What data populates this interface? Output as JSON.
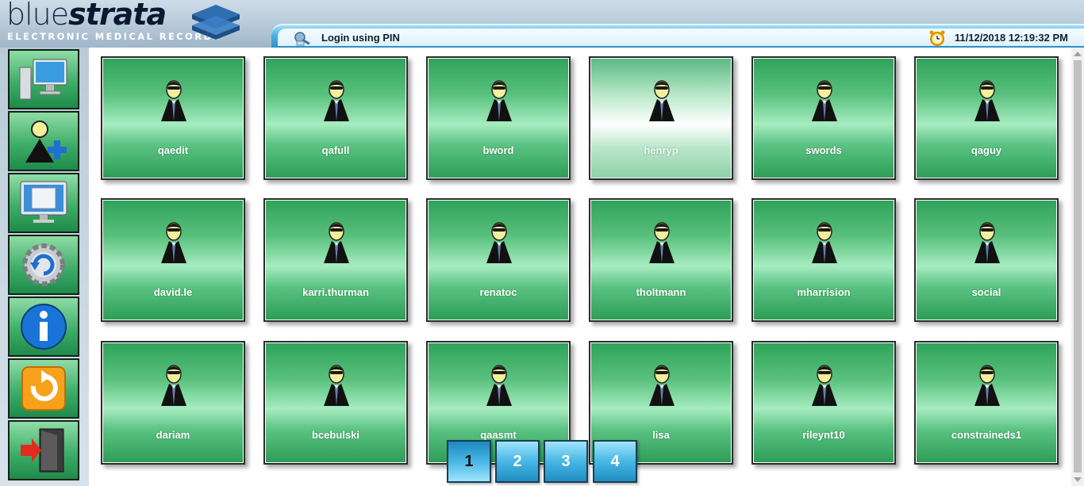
{
  "logo": {
    "light": "blue",
    "bold": "strata",
    "subtitle": "ELECTRONIC MEDICAL RECORDS"
  },
  "topbar": {
    "login_label": "Login using PIN",
    "datetime": "11/12/2018 12:19:32 PM"
  },
  "sidebar": {
    "items": [
      {
        "icon": "computer-monitor-icon"
      },
      {
        "icon": "add-user-icon"
      },
      {
        "icon": "desktop-window-icon"
      },
      {
        "icon": "refresh-gear-icon"
      },
      {
        "icon": "info-icon"
      },
      {
        "icon": "undo-arrow-icon"
      },
      {
        "icon": "exit-door-icon"
      }
    ]
  },
  "users": [
    {
      "name": "qaedit"
    },
    {
      "name": "qafull"
    },
    {
      "name": "bword"
    },
    {
      "name": "henryp"
    },
    {
      "name": "swords"
    },
    {
      "name": "qaguy"
    },
    {
      "name": "david.le"
    },
    {
      "name": "karri.thurman"
    },
    {
      "name": "renatoc"
    },
    {
      "name": "tholtmann"
    },
    {
      "name": "mharrision"
    },
    {
      "name": "social"
    },
    {
      "name": "dariam"
    },
    {
      "name": "bcebulski"
    },
    {
      "name": "qaasmt"
    },
    {
      "name": "lisa"
    },
    {
      "name": "rileynt10"
    },
    {
      "name": "constraineds1"
    }
  ],
  "highlighted_user": "henryp",
  "pager": {
    "pages": [
      "1",
      "2",
      "3",
      "4"
    ],
    "current": "1"
  },
  "colors": {
    "tile_green": "#3fae6a",
    "topbar_blue": "#4fb2e0",
    "pager_blue": "#47b7e4"
  }
}
